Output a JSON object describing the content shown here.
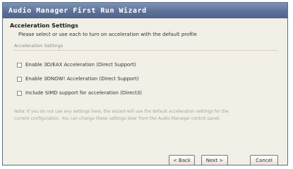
{
  "window": {
    "title": "Audio Manager First Run Wizard"
  },
  "page": {
    "section_title": "Acceleration Settings",
    "hint": "Please select or use each to turn on acceleration with the default profile",
    "group_label": "Acceleration Settings",
    "options": [
      "Enable 3D/EAX Acceleration (Direct Support)",
      "Enable 3DNOW! Acceleration (Direct Support)",
      "Include SIMD support for acceleration (Direct3)"
    ],
    "note": "Note: If you do not use any settings here, the wizard will use the default acceleration settings for the current configuration. You can change these settings later from the Audio Manager control panel."
  },
  "buttons": {
    "back": "< Back",
    "next": "Next >",
    "cancel": "Cancel"
  }
}
